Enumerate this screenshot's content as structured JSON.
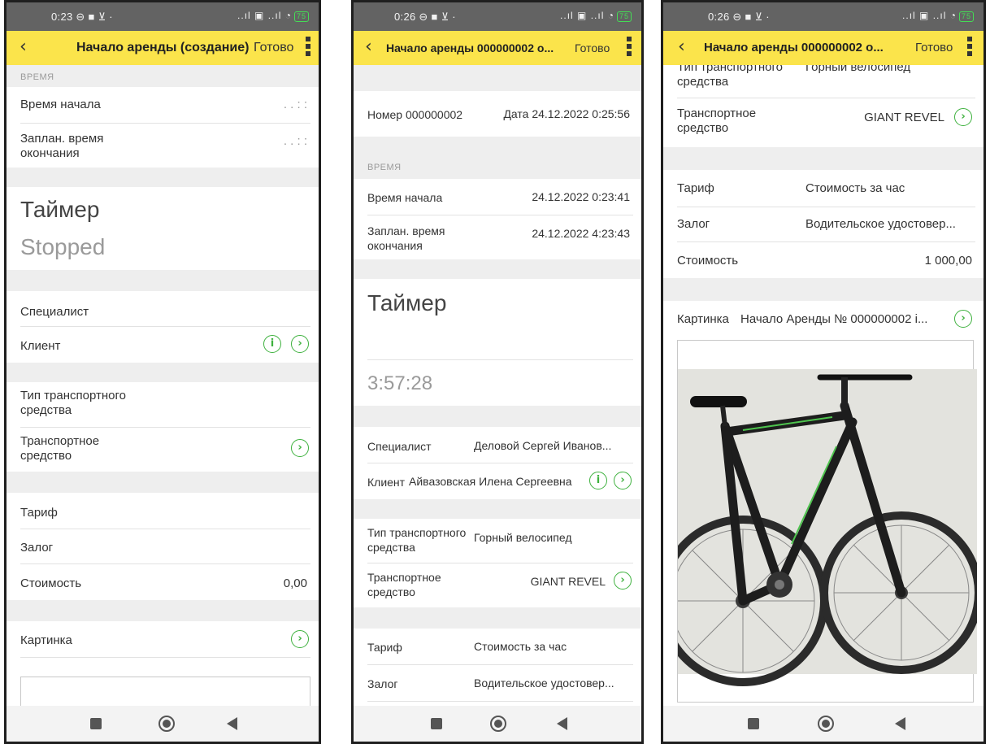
{
  "status": {
    "time1": "0:23 ⊖ ■ ⊻ ·",
    "time2": "0:26 ⊖ ■ ⊻ ·",
    "time3": "0:26 ⊖ ■ ⊻ ·",
    "icons": "..ıl ▣ ..ıl ◔",
    "battery": "75"
  },
  "screen1": {
    "title": "Начало аренды (создание)",
    "done": "Готово",
    "section_time": "ВРЕМЯ",
    "start_label": "Время начала",
    "start_value": ". .    : :",
    "end_label_line1": "Заплан. время",
    "end_label_line2": "окончания",
    "end_value": ". .    : :",
    "timer_label": "Таймер",
    "timer_state": "Stopped",
    "specialist_label": "Специалист",
    "client_label": "Клиент",
    "vehicle_type_line1": "Тип транспортного",
    "vehicle_type_line2": "средства",
    "vehicle_line1": "Транспортное",
    "vehicle_line2": "средство",
    "tariff_label": "Тариф",
    "deposit_label": "Залог",
    "cost_label": "Стоимость",
    "cost_value": "0,00",
    "picture_label": "Картинка"
  },
  "screen2": {
    "title": "Начало аренды 000000002 о...",
    "done": "Готово",
    "number_label": "Номер 000000002",
    "date_label": "Дата 24.12.2022 0:25:56",
    "section_time": "ВРЕМЯ",
    "start_label": "Время начала",
    "start_value": "24.12.2022 0:23:41",
    "end_label_line1": "Заплан. время",
    "end_label_line2": "окончания",
    "end_value": "24.12.2022 4:23:43",
    "timer_label": "Таймер",
    "timer_value": "3:57:28",
    "specialist_label": "Специалист",
    "specialist_value": "Деловой Сергей Иванов...",
    "client_label": "Клиент",
    "client_value": "Айвазовская Илена Сергеевна",
    "vehicle_type_line1": "Тип транспортного",
    "vehicle_type_line2": "средства",
    "vehicle_type_value": "Горный велосипед",
    "vehicle_line1": "Транспортное",
    "vehicle_line2": "средство",
    "vehicle_value": "GIANT REVEL",
    "tariff_label": "Тариф",
    "tariff_value": "Стоимость за час",
    "deposit_label": "Залог",
    "deposit_value": "Водительское удостовер..."
  },
  "screen3": {
    "title": "Начало аренды 000000002 о...",
    "done": "Готово",
    "vehicle_type_line1": "Тип транспортного",
    "vehicle_type_line2": "средства",
    "vehicle_type_value": "Горный велосипед",
    "vehicle_line1": "Транспортное",
    "vehicle_line2": "средство",
    "vehicle_value": "GIANT REVEL",
    "tariff_label": "Тариф",
    "tariff_value": "Стоимость за час",
    "deposit_label": "Залог",
    "deposit_value": "Водительское удостовер...",
    "cost_label": "Стоимость",
    "cost_value": "1 000,00",
    "picture_label": "Картинка",
    "picture_value": "Начало Аренды № 000000002 i..."
  },
  "icons": {
    "info": "i",
    "arrow": "›",
    "back": "‹"
  },
  "colors": {
    "titlebar": "#fbe44b",
    "statusbar": "#636363",
    "accent_green": "#3eb13e"
  }
}
